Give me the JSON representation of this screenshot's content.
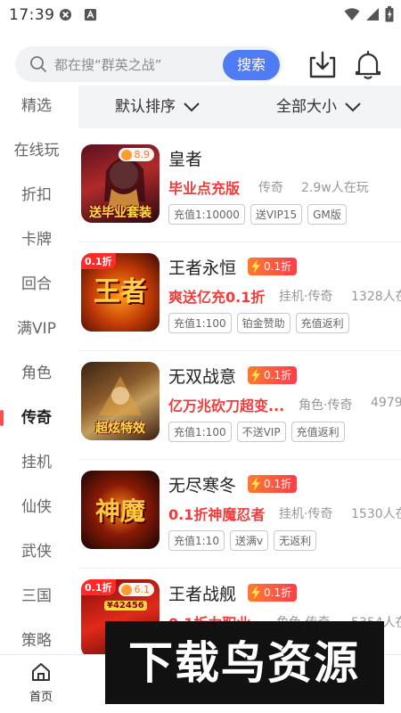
{
  "status": {
    "time": "17:39"
  },
  "search": {
    "placeholder": "都在搜“群英之战”",
    "button": "搜索"
  },
  "sidebar": {
    "items": [
      {
        "label": "精选"
      },
      {
        "label": "在线玩"
      },
      {
        "label": "折扣"
      },
      {
        "label": "卡牌"
      },
      {
        "label": "回合"
      },
      {
        "label": "满VIP"
      },
      {
        "label": "角色"
      },
      {
        "label": "传奇"
      },
      {
        "label": "挂机"
      },
      {
        "label": "仙侠"
      },
      {
        "label": "武侠"
      },
      {
        "label": "三国"
      },
      {
        "label": "策略"
      }
    ],
    "active": "传奇"
  },
  "filters": {
    "sort": "默认排序",
    "size": "全部大小"
  },
  "games": [
    {
      "name": "皇者",
      "rating": "8.9",
      "promo": "毕业点充版",
      "category": "传奇",
      "players": "2.9w人在玩",
      "tags": [
        "充值1:10000",
        "送VIP15",
        "GM版"
      ],
      "icon_banner": "送毕业套装"
    },
    {
      "name": "王者永恒",
      "discount": "0.1折",
      "promo": "爽送亿充0.1折",
      "category": "挂机·传奇",
      "players": "1328人在",
      "tags": [
        "充值1:100",
        "铂金赞助",
        "充值返利"
      ],
      "icon_corner": "0.1折",
      "icon_glyph": "王者"
    },
    {
      "name": "无双战意",
      "discount": "0.1折",
      "promo": "亿万兆砍刀超变...",
      "category": "角色·传奇",
      "players": "4979",
      "tags": [
        "充值1:100",
        "不送VIP",
        "充值返利"
      ],
      "icon_banner": "超炫特效"
    },
    {
      "name": "无尽寒冬",
      "discount": "0.1折",
      "promo": "0.1折神魔忍者",
      "category": "挂机·传奇",
      "players": "1530人在",
      "tags": [
        "充值1:10",
        "送满v",
        "无返利"
      ],
      "icon_glyph": "神魔"
    },
    {
      "name": "王者战舰",
      "discount": "0.1折",
      "rating": "6.1",
      "promo": "0.1折力职业",
      "category": "角色·传奇",
      "players": "5354人在",
      "tags": [],
      "icon_corner": "0.1折",
      "icon_strip": "¥42456"
    }
  ],
  "bottom_nav": {
    "home": "首页"
  },
  "watermark": {
    "text": "下载鸟资源"
  },
  "colors": {
    "accent": "#4f7cf2",
    "promo": "#f23c3c",
    "discount": "#ff4d3a",
    "active_indicator": "#ff4d4f"
  }
}
